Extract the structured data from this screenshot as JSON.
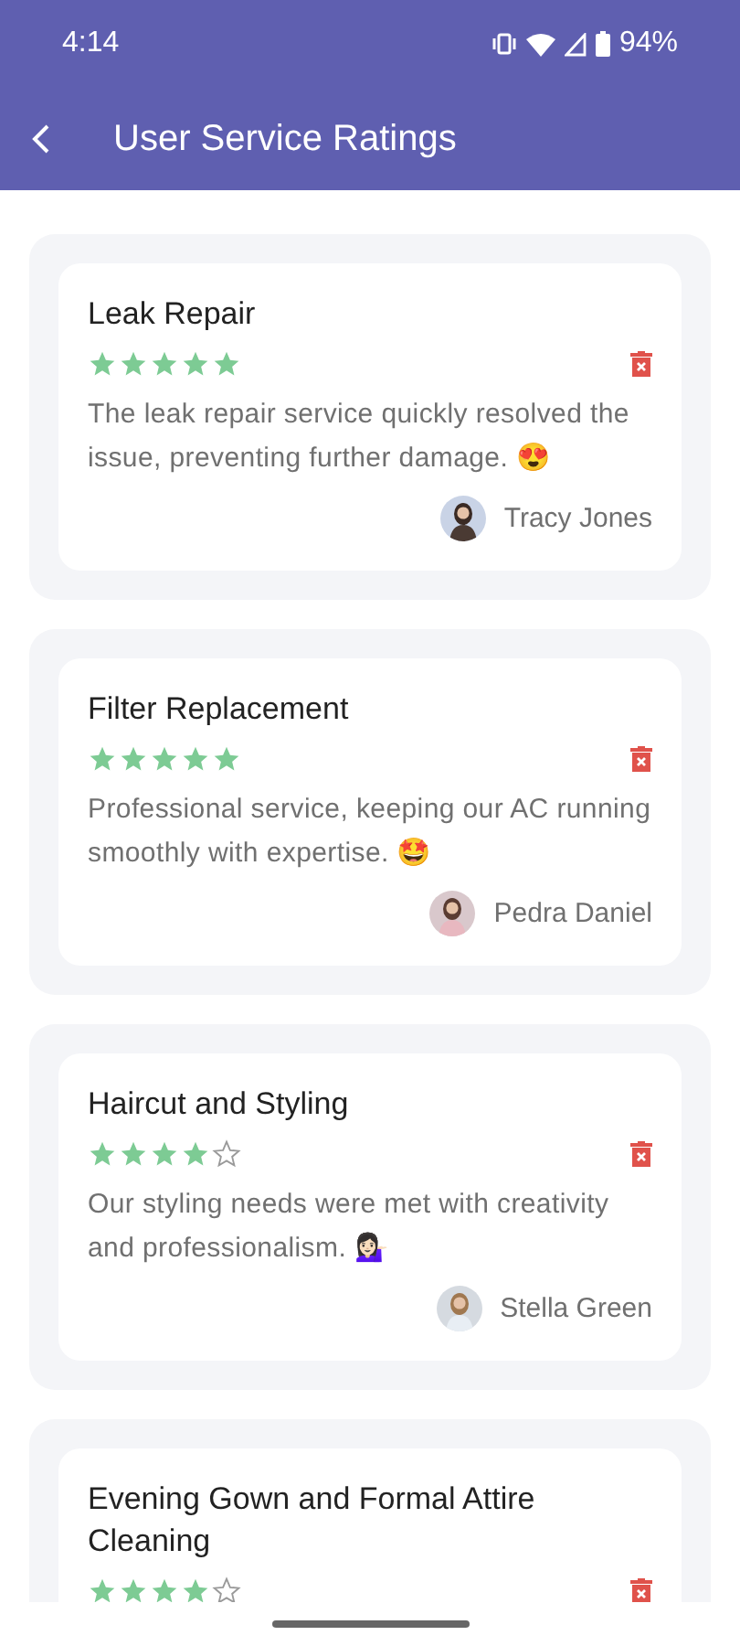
{
  "status_bar": {
    "time": "4:14",
    "battery": "94%"
  },
  "header": {
    "title": "User Service Ratings"
  },
  "reviews": [
    {
      "service": "Leak Repair",
      "stars": 5,
      "comment": "The leak repair service quickly resolved the issue, preventing further damage. 😍",
      "author": "Tracy Jones"
    },
    {
      "service": "Filter Replacement",
      "stars": 5,
      "comment": "Professional service, keeping our AC running smoothly with expertise. 🤩",
      "author": "Pedra Daniel"
    },
    {
      "service": "Haircut and Styling",
      "stars": 4,
      "comment": "Our styling needs were met with creativity and professionalism. 💁🏻‍♀️",
      "author": "Stella Green"
    },
    {
      "service": "Evening Gown and Formal Attire Cleaning",
      "stars": 4
    }
  ]
}
